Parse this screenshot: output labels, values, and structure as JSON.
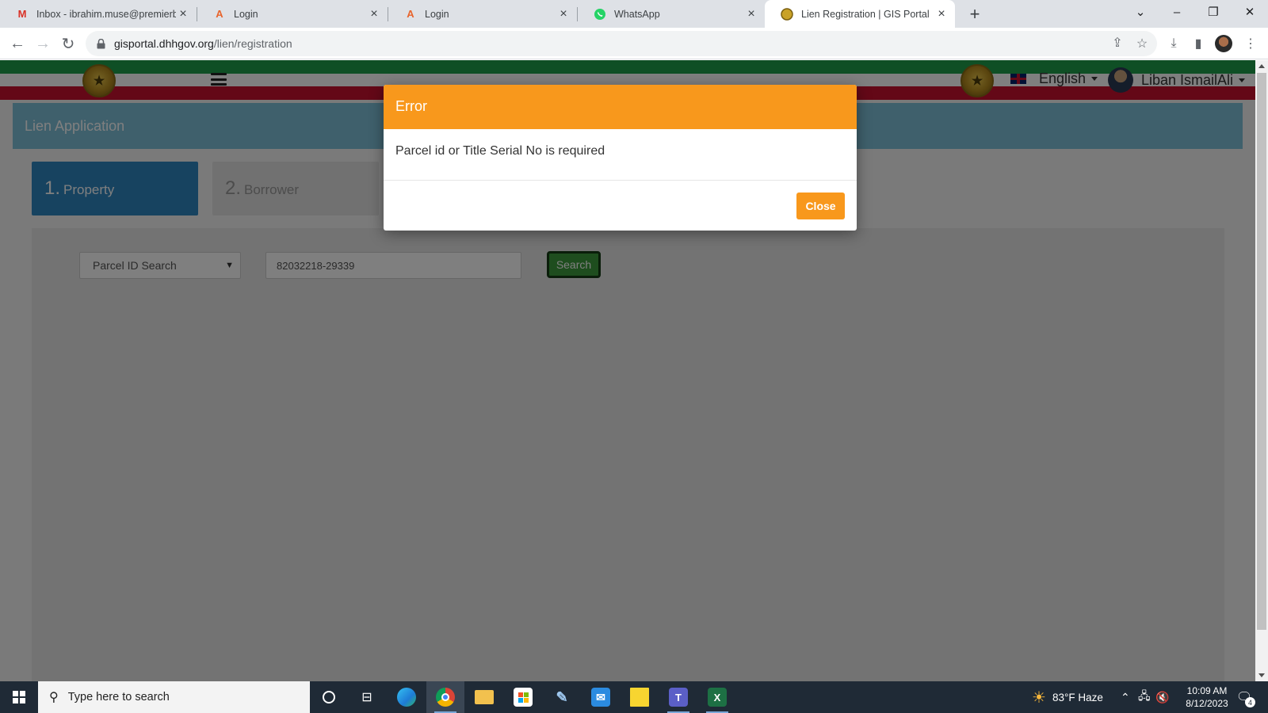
{
  "browser": {
    "tabs": [
      {
        "title": "Inbox - ibrahim.muse@premierb",
        "icon": "gmail-icon",
        "active": false
      },
      {
        "title": "Login",
        "icon": "login-a-icon",
        "active": false
      },
      {
        "title": "Login",
        "icon": "login-a-icon",
        "active": false
      },
      {
        "title": "WhatsApp",
        "icon": "whatsapp-icon",
        "active": false
      },
      {
        "title": "Lien Registration | GIS Portal",
        "icon": "gis-portal-icon",
        "active": true
      }
    ],
    "url_host": "gisportal.dhhgov.org",
    "url_path": "/lien/registration"
  },
  "header": {
    "language": "English",
    "user_name": "Liban IsmailAli",
    "stripe_colors": {
      "green": "#1f9e4a",
      "white": "#ffffff",
      "red": "#c8102e"
    }
  },
  "main": {
    "panel_title": "Lien Application",
    "steps": [
      {
        "number": "1.",
        "label": "Property",
        "active": true
      },
      {
        "number": "2.",
        "label": "Borrower",
        "active": false
      }
    ],
    "search_type_selected": "Parcel ID Search",
    "search_value": "82032218-29339",
    "search_button": "Search"
  },
  "modal": {
    "title": "Error",
    "message": "Parcel id or Title Serial No is required",
    "close_label": "Close",
    "accent_color": "#f8981c"
  },
  "taskbar": {
    "search_placeholder": "Type here to search",
    "weather": "83°F  Haze",
    "time": "10:09 AM",
    "date": "8/12/2023",
    "notification_count": "4"
  }
}
